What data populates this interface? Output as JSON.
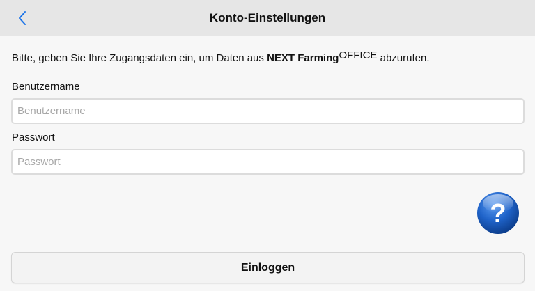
{
  "navbar": {
    "title": "Konto-Einstellungen",
    "back_icon": "chevron-left-icon",
    "back_color": "#1a73e8"
  },
  "intro": {
    "text_before": "Bitte, geben Sie Ihre Zugangsdaten ein, um Daten aus ",
    "brand": "NEXT Farming",
    "brand_superscript": "OFFICE",
    "text_after": " abzurufen."
  },
  "form": {
    "username": {
      "label": "Benutzername",
      "value": "",
      "placeholder": "Benutzername"
    },
    "password": {
      "label": "Passwort",
      "value": "",
      "placeholder": "Passwort"
    }
  },
  "help": {
    "icon": "question-mark-icon",
    "color": "#1c62c4"
  },
  "actions": {
    "login_label": "Einloggen"
  }
}
